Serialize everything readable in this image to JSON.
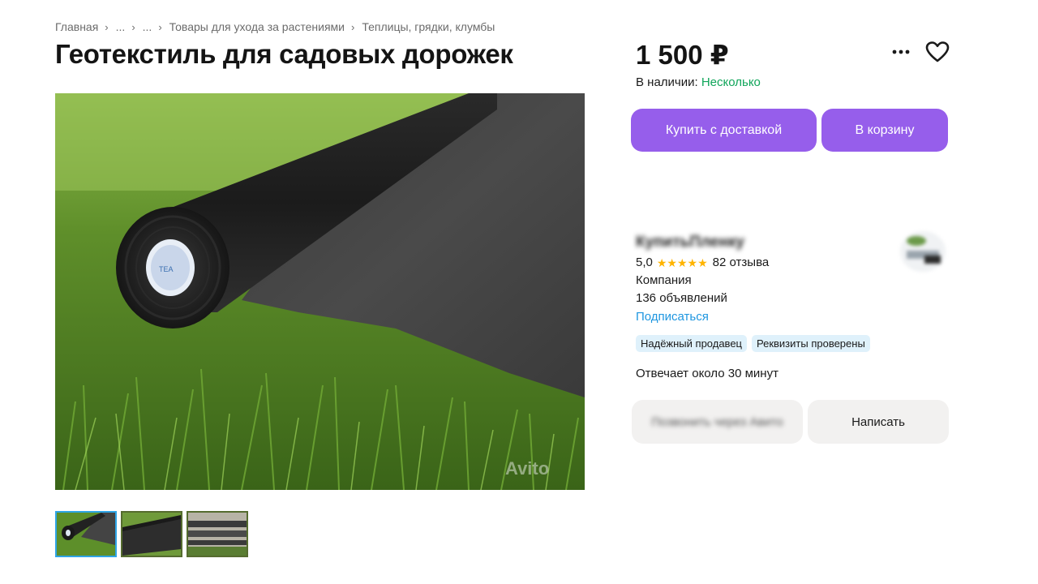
{
  "breadcrumb": {
    "items": [
      "Главная",
      "...",
      "...",
      "Товары для ухода за растениями",
      "Теплицы, грядки, клумбы"
    ],
    "separator": "›"
  },
  "product": {
    "title": "Геотекстиль для садовых дорожек",
    "price": "1 500 ₽",
    "stock_label": "В наличии:",
    "stock_value": "Несколько",
    "watermark": "Avito"
  },
  "actions": {
    "buy_delivery": "Купить с доставкой",
    "add_to_cart": "В корзину",
    "more_icon": "more-dots-icon",
    "favorite_icon": "heart-outline-icon"
  },
  "seller": {
    "name": "КупитьПленку",
    "rating": "5,0",
    "stars": 5,
    "reviews": "82 отзыва",
    "type": "Компания",
    "listings": "136 объявлений",
    "subscribe": "Подписаться",
    "badges": [
      "Надёжный продавец",
      "Реквизиты проверены"
    ],
    "response_time": "Отвечает около 30 минут",
    "call_button": "Позвонить через Авито",
    "message_button": "Написать"
  },
  "gallery": {
    "thumbnails": [
      "thumb-1",
      "thumb-2",
      "thumb-3"
    ],
    "active_index": 0
  },
  "colors": {
    "accent_purple": "#965EEB",
    "stock_green": "#10A55A",
    "link_blue": "#1E96E0",
    "badge_bg": "#DFF1FB",
    "star_color": "#FFB400"
  }
}
